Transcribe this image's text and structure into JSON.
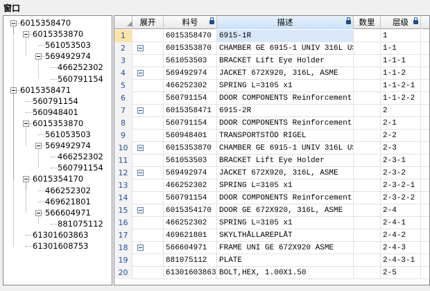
{
  "window": {
    "title": "窗口"
  },
  "tree": [
    {
      "label": "6015358470",
      "level": 0,
      "box": true
    },
    {
      "label": "6015353870",
      "level": 1,
      "box": true
    },
    {
      "label": "561053503",
      "level": 2,
      "box": false
    },
    {
      "label": "569492974",
      "level": 2,
      "box": true
    },
    {
      "label": "466252302",
      "level": 3,
      "box": false
    },
    {
      "label": "560791154",
      "level": 3,
      "box": false
    },
    {
      "label": "6015358471",
      "level": 0,
      "box": true
    },
    {
      "label": "560791154",
      "level": 1,
      "box": false
    },
    {
      "label": "560948401",
      "level": 1,
      "box": false
    },
    {
      "label": "6015353870",
      "level": 1,
      "box": true
    },
    {
      "label": "561053503",
      "level": 2,
      "box": false
    },
    {
      "label": "569492974",
      "level": 2,
      "box": true
    },
    {
      "label": "466252302",
      "level": 3,
      "box": false
    },
    {
      "label": "560791154",
      "level": 3,
      "box": false
    },
    {
      "label": "6015354170",
      "level": 1,
      "box": true
    },
    {
      "label": "466252302",
      "level": 2,
      "box": false
    },
    {
      "label": "469621801",
      "level": 2,
      "box": false
    },
    {
      "label": "566604971",
      "level": 2,
      "box": true
    },
    {
      "label": "881075112",
      "level": 3,
      "box": false
    },
    {
      "label": "61301603863",
      "level": 1,
      "box": false
    },
    {
      "label": "61301608753",
      "level": 1,
      "box": false
    }
  ],
  "grid": {
    "columns": [
      {
        "key": "rownum",
        "label": ""
      },
      {
        "key": "expand",
        "label": "展开"
      },
      {
        "key": "part",
        "label": "料号"
      },
      {
        "key": "desc",
        "label": "描述"
      },
      {
        "key": "qty",
        "label": "数里"
      },
      {
        "key": "level",
        "label": "层级"
      }
    ],
    "rows": [
      {
        "n": "1",
        "exp": false,
        "part": "6015358470",
        "desc": "6915-1R",
        "qty": "",
        "level": "1"
      },
      {
        "n": "2",
        "exp": true,
        "part": "6015353870",
        "desc": "CHAMBER GE 6915-1 UNIV 316L US",
        "qty": "",
        "level": "1-1"
      },
      {
        "n": "3",
        "exp": false,
        "part": "561053503",
        "desc": "BRACKET Lift Eye Holder",
        "qty": "",
        "level": "1-1-1"
      },
      {
        "n": "4",
        "exp": true,
        "part": "569492974",
        "desc": "JACKET 672X920, 316L, ASME",
        "qty": "",
        "level": "1-1-2"
      },
      {
        "n": "5",
        "exp": false,
        "part": "466252302",
        "desc": "SPRING L=3105 x1",
        "qty": "",
        "level": "1-1-2-1"
      },
      {
        "n": "6",
        "exp": false,
        "part": "560791154",
        "desc": "DOOR COMPONENTS Reinforcement",
        "qty": "",
        "level": "1-1-2-2"
      },
      {
        "n": "7",
        "exp": true,
        "part": "6015358471",
        "desc": "6915-2R",
        "qty": "",
        "level": "2"
      },
      {
        "n": "8",
        "exp": false,
        "part": "560791154",
        "desc": "DOOR COMPONENTS Reinforcement",
        "qty": "",
        "level": "2-1"
      },
      {
        "n": "9",
        "exp": false,
        "part": "560948401",
        "desc": "TRANSPORTSTÖD RIGEL",
        "qty": "",
        "level": "2-2"
      },
      {
        "n": "10",
        "exp": true,
        "part": "6015353870",
        "desc": "CHAMBER GE 6915-1 UNIV 316L US",
        "qty": "",
        "level": "2-3"
      },
      {
        "n": "11",
        "exp": false,
        "part": "561053503",
        "desc": "BRACKET Lift Eye Holder",
        "qty": "",
        "level": "2-3-1"
      },
      {
        "n": "12",
        "exp": true,
        "part": "569492974",
        "desc": "JACKET 672X920, 316L, ASME",
        "qty": "",
        "level": "2-3-2"
      },
      {
        "n": "13",
        "exp": false,
        "part": "466252302",
        "desc": "SPRING L=3105 x1",
        "qty": "",
        "level": "2-3-2-1"
      },
      {
        "n": "14",
        "exp": false,
        "part": "560791154",
        "desc": "DOOR COMPONENTS Reinforcement",
        "qty": "",
        "level": "2-3-2-2"
      },
      {
        "n": "15",
        "exp": true,
        "part": "6015354170",
        "desc": "DOOR GE 672X920, 316L, ASME",
        "qty": "",
        "level": "2-4"
      },
      {
        "n": "16",
        "exp": false,
        "part": "466252302",
        "desc": "SPRING L=3105 x1",
        "qty": "",
        "level": "2-4-1"
      },
      {
        "n": "17",
        "exp": false,
        "part": "469621801",
        "desc": "SKYLTHÅLLAREPLÅT",
        "qty": "",
        "level": "2-4-2"
      },
      {
        "n": "18",
        "exp": true,
        "part": "566604971",
        "desc": "FRAME UNI GE 672X920 ASME",
        "qty": "",
        "level": "2-4-3"
      },
      {
        "n": "19",
        "exp": false,
        "part": "881075112",
        "desc": "PLATE",
        "qty": "",
        "level": "2-4-3-1"
      },
      {
        "n": "20",
        "exp": false,
        "part": "61301603863",
        "desc": "BOLT,HEX,  1.00X1.50",
        "qty": "",
        "level": "2-5"
      }
    ]
  }
}
